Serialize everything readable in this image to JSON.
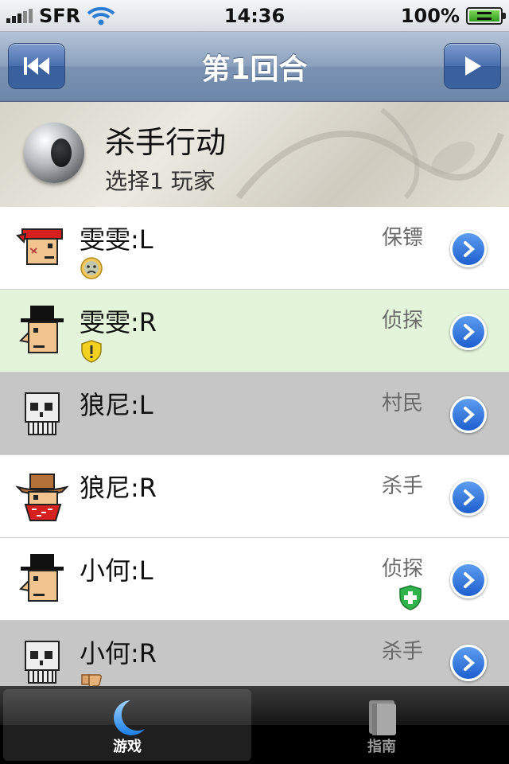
{
  "status_bar": {
    "carrier": "SFR",
    "time": "14:36",
    "battery": "100%"
  },
  "nav": {
    "title": "第1回合",
    "left_icon": "skip-back-icon",
    "right_icon": "play-icon"
  },
  "banner": {
    "title": "杀手行动",
    "subtitle": "选择1 玩家",
    "icon": "eye-icon"
  },
  "players": [
    {
      "name": "雯雯:L",
      "role": "保镖",
      "avatar": "bandana-avatar",
      "badge": "worried-face-icon",
      "badge_side": "left",
      "row": "white"
    },
    {
      "name": "雯雯:R",
      "role": "侦探",
      "avatar": "tophat-avatar",
      "badge": "warning-shield-icon",
      "badge_side": "left",
      "row": "green"
    },
    {
      "name": "狼尼:L",
      "role": "村民",
      "avatar": "skull-avatar",
      "badge": "",
      "badge_side": "",
      "row": "gray"
    },
    {
      "name": "狼尼:R",
      "role": "杀手",
      "avatar": "cowboy-avatar",
      "badge": "",
      "badge_side": "",
      "row": "white"
    },
    {
      "name": "小何:L",
      "role": "侦探",
      "avatar": "tophat-avatar",
      "badge": "green-cross-shield-icon",
      "badge_side": "right",
      "row": "white"
    },
    {
      "name": "小何:R",
      "role": "杀手",
      "avatar": "skull-avatar",
      "badge": "thumbs-down-icon",
      "badge_side": "left",
      "row": "gray"
    }
  ],
  "tabs": [
    {
      "label": "游戏",
      "icon": "moon-icon",
      "active": true
    },
    {
      "label": "指南",
      "icon": "book-icon",
      "active": false
    }
  ]
}
